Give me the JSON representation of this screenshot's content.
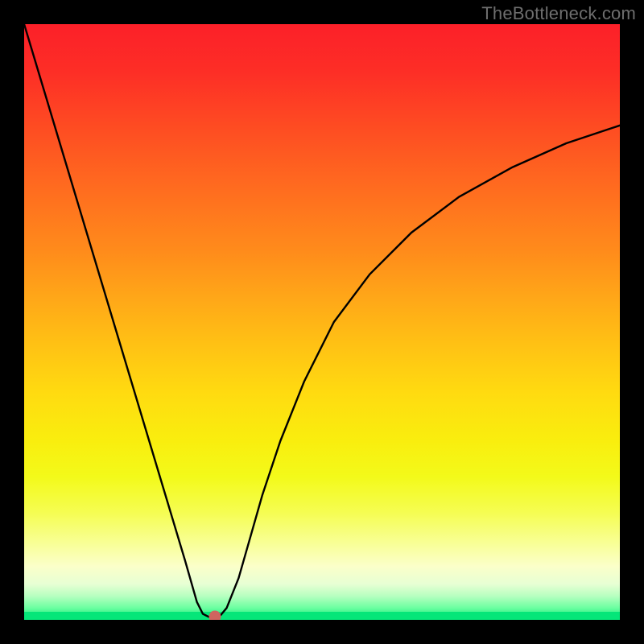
{
  "watermark": "TheBottleneck.com",
  "chart_data": {
    "type": "line",
    "title": "",
    "xlabel": "",
    "ylabel": "",
    "xlim": [
      0,
      100
    ],
    "ylim": [
      0,
      100
    ],
    "grid": false,
    "series": [
      {
        "name": "curve",
        "x": [
          0,
          3,
          6,
          9,
          12,
          15,
          18,
          21,
          24,
          27,
          29,
          30,
          31,
          32,
          33,
          34,
          36,
          38,
          40,
          43,
          47,
          52,
          58,
          65,
          73,
          82,
          91,
          100
        ],
        "y": [
          100,
          90,
          80,
          70,
          60,
          50,
          40,
          30,
          20,
          10,
          3,
          1,
          0.5,
          0.5,
          0.8,
          2,
          7,
          14,
          21,
          30,
          40,
          50,
          58,
          65,
          71,
          76,
          80,
          83
        ]
      }
    ],
    "annotation_point": {
      "x": 32,
      "y": 0.5
    },
    "background_gradient": {
      "top": "#fc2029",
      "mid": "#ffdb10",
      "bottom": "#05e679"
    }
  }
}
